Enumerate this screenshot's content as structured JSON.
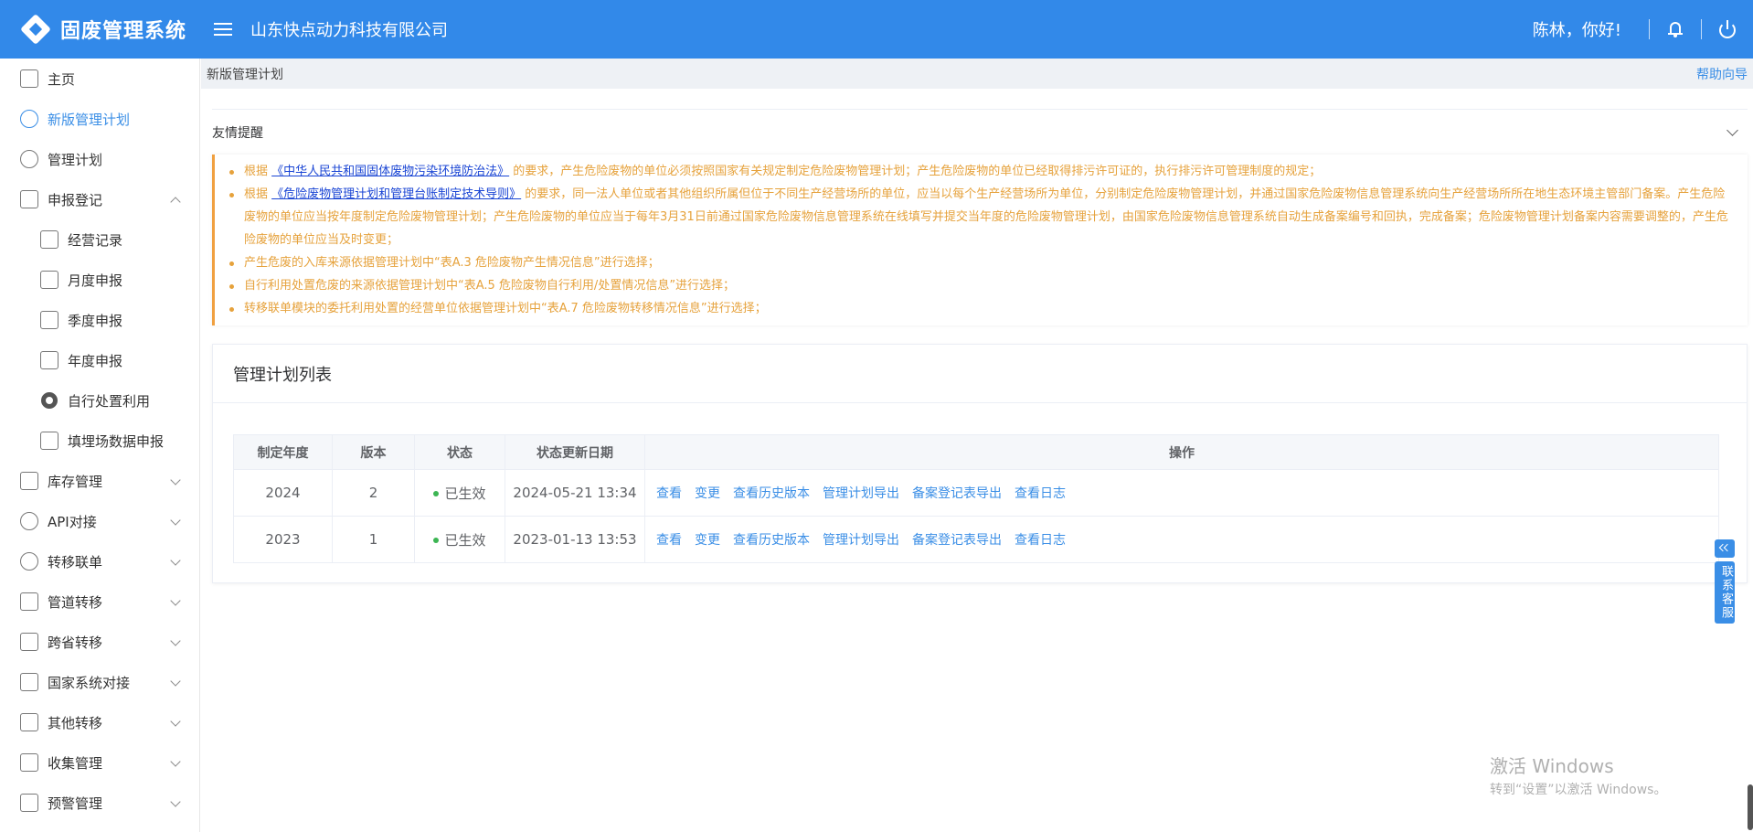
{
  "header": {
    "app_title": "固废管理系统",
    "company": "山东快点动力科技有限公司",
    "greeting": "陈林，你好!",
    "brand_color": "#3289e9"
  },
  "sidebar": {
    "items": [
      {
        "label": "主页",
        "icon": "home-icon"
      },
      {
        "label": "新版管理计划",
        "icon": "plan-icon",
        "active": true
      },
      {
        "label": "管理计划",
        "icon": "plan-old-icon"
      },
      {
        "label": "申报登记",
        "icon": "declare-icon",
        "expanded": true
      },
      {
        "label": "经营记录",
        "icon": "record-icon"
      },
      {
        "label": "月度申报",
        "icon": "month-icon"
      },
      {
        "label": "季度申报",
        "icon": "quarter-icon"
      },
      {
        "label": "年度申报",
        "icon": "year-icon"
      },
      {
        "label": "自行处置利用",
        "icon": "dispose-icon"
      },
      {
        "label": "填埋场数据申报",
        "icon": "landfill-icon"
      },
      {
        "label": "库存管理",
        "icon": "warehouse-icon"
      },
      {
        "label": "API对接",
        "icon": "api-icon"
      },
      {
        "label": "转移联单",
        "icon": "transfer-icon"
      },
      {
        "label": "管道转移",
        "icon": "pipe-icon"
      },
      {
        "label": "跨省转移",
        "icon": "cross-province-icon"
      },
      {
        "label": "国家系统对接",
        "icon": "national-icon"
      },
      {
        "label": "其他转移",
        "icon": "other-transfer-icon"
      },
      {
        "label": "收集管理",
        "icon": "collect-icon"
      },
      {
        "label": "预警管理",
        "icon": "warning-icon"
      }
    ]
  },
  "breadcrumb": {
    "current": "新版管理计划",
    "help": "帮助向导"
  },
  "tips": {
    "title": "友情提醒",
    "lines": [
      {
        "pre": "根据 ",
        "link": "《中华人民共和国固体废物污染环境防治法》",
        "post": " 的要求，产生危险废物的单位必须按照国家有关规定制定危险废物管理计划；产生危险废物的单位已经取得排污许可证的，执行排污许可管理制度的规定；"
      },
      {
        "pre": "根据 ",
        "link": "《危险废物管理计划和管理台账制定技术导则》",
        "post": " 的要求，同一法人单位或者其他组织所属但位于不同生产经营场所的单位，应当以每个生产经营场所为单位，分别制定危险废物管理计划，并通过国家危险废物信息管理系统向生产经营场所所在地生态环境主管部门备案。产生危险废物的单位应当按年度制定危险废物管理计划；产生危险废物的单位应当于每年3月31日前通过国家危险废物信息管理系统在线填写并提交当年度的危险废物管理计划，由国家危险废物信息管理系统自动生成备案编号和回执，完成备案；危险废物管理计划备案内容需要调整的，产生危险废物的单位应当及时变更；"
      },
      {
        "pre": "产生危废的入库来源依据管理计划中“表A.3 危险废物产生情况信息”进行选择；",
        "link": "",
        "post": ""
      },
      {
        "pre": "自行利用处置危废的来源依据管理计划中“表A.5 危险废物自行利用/处置情况信息”进行选择；",
        "link": "",
        "post": ""
      },
      {
        "pre": "转移联单模块的委托利用处置的经营单位依据管理计划中“表A.7 危险废物转移情况信息”进行选择；",
        "link": "",
        "post": ""
      }
    ]
  },
  "plan_list": {
    "title": "管理计划列表",
    "columns": [
      "制定年度",
      "版本",
      "状态",
      "状态更新日期",
      "操作"
    ],
    "rows": [
      {
        "year": "2024",
        "version": "2",
        "status": "已生效",
        "updated": "2024-05-21 13:34"
      },
      {
        "year": "2023",
        "version": "1",
        "status": "已生效",
        "updated": "2023-01-13 13:53"
      }
    ],
    "actions": [
      "查看",
      "变更",
      "查看历史版本",
      "管理计划导出",
      "备案登记表导出",
      "查看日志"
    ]
  },
  "kefu": {
    "label": "联系客服"
  },
  "watermark": {
    "line1": "激活 Windows",
    "line2": "转到“设置”以激活 Windows。"
  }
}
